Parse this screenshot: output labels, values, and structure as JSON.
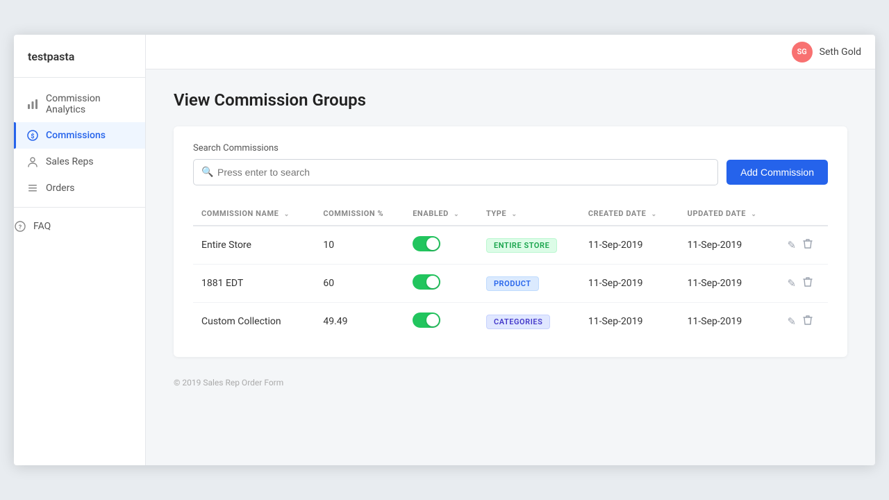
{
  "app": {
    "name": "testpasta"
  },
  "user": {
    "initials": "SG",
    "name": "Seth Gold"
  },
  "sidebar": {
    "items": [
      {
        "id": "commission-analytics",
        "label": "Commission Analytics",
        "icon": "chart-icon",
        "active": false
      },
      {
        "id": "commissions",
        "label": "Commissions",
        "icon": "dollar-icon",
        "active": true
      },
      {
        "id": "sales-reps",
        "label": "Sales Reps",
        "icon": "person-icon",
        "active": false
      },
      {
        "id": "orders",
        "label": "Orders",
        "icon": "list-icon",
        "active": false
      }
    ],
    "faq": {
      "label": "FAQ",
      "icon": "help-icon"
    }
  },
  "page": {
    "title": "View Commission Groups"
  },
  "search": {
    "label": "Search Commissions",
    "placeholder": "Press enter to search",
    "value": ""
  },
  "add_button": {
    "label": "Add Commission"
  },
  "table": {
    "columns": [
      {
        "id": "name",
        "label": "Commission Name",
        "sortable": true
      },
      {
        "id": "percent",
        "label": "Commission %",
        "sortable": false
      },
      {
        "id": "enabled",
        "label": "Enabled",
        "sortable": true
      },
      {
        "id": "type",
        "label": "Type",
        "sortable": true
      },
      {
        "id": "created_date",
        "label": "Created Date",
        "sortable": true
      },
      {
        "id": "updated_date",
        "label": "Updated Date",
        "sortable": true
      },
      {
        "id": "actions",
        "label": "",
        "sortable": false
      }
    ],
    "rows": [
      {
        "id": 1,
        "name": "Entire Store",
        "percent": "10",
        "enabled": true,
        "type": "ENTIRE STORE",
        "type_class": "badge-store",
        "created_date": "11-Sep-2019",
        "updated_date": "11-Sep-2019"
      },
      {
        "id": 2,
        "name": "1881 EDT",
        "percent": "60",
        "enabled": true,
        "type": "PRODUCT",
        "type_class": "badge-product",
        "created_date": "11-Sep-2019",
        "updated_date": "11-Sep-2019"
      },
      {
        "id": 3,
        "name": "Custom Collection",
        "percent": "49.49",
        "enabled": true,
        "type": "CATEGORIES",
        "type_class": "badge-categories",
        "created_date": "11-Sep-2019",
        "updated_date": "11-Sep-2019"
      }
    ]
  },
  "footer": {
    "text": "© 2019 Sales Rep Order Form"
  }
}
